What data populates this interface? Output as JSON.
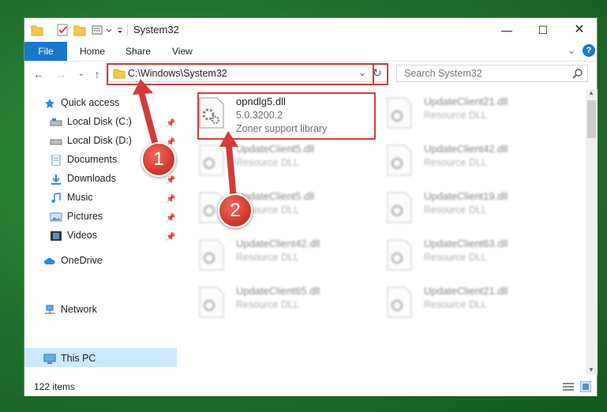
{
  "window": {
    "title": "System32"
  },
  "ribbon": {
    "file": "File",
    "home": "Home",
    "share": "Share",
    "view": "View"
  },
  "address": {
    "path": "C:\\Windows\\System32"
  },
  "search": {
    "placeholder": "Search System32"
  },
  "sidebar": {
    "quick_access": "Quick access",
    "items": [
      "Local Disk (C:)",
      "Local Disk (D:)",
      "Documents",
      "Downloads",
      "Music",
      "Pictures",
      "Videos"
    ],
    "onedrive": "OneDrive",
    "this_pc": "This PC",
    "network": "Network"
  },
  "files": {
    "selected": {
      "name": "opndlg5.dll",
      "version": "5.0.3200.2",
      "desc": "Zoner support library"
    },
    "others": [
      {
        "name": "UpdateClient21.dll",
        "desc": "Resource DLL"
      },
      {
        "name": "UpdateClient5.dll",
        "desc": "Resource DLL"
      },
      {
        "name": "UpdateClient42.dll",
        "desc": "Resource DLL"
      },
      {
        "name": "UpdateClient5.dll",
        "desc": "Resource DLL"
      },
      {
        "name": "UpdateClient19.dll",
        "desc": "Resource DLL"
      },
      {
        "name": "UpdateClient42.dll",
        "desc": "Resource DLL"
      },
      {
        "name": "UpdateClient63.dll",
        "desc": "Resource DLL"
      },
      {
        "name": "UpdateClient65.dll",
        "desc": "Resource DLL"
      },
      {
        "name": "UpdateClient21.dll",
        "desc": "Resource DLL"
      }
    ]
  },
  "status": {
    "count": "122 items"
  },
  "annotations": {
    "step1": "1",
    "step2": "2"
  },
  "colors": {
    "accent": "#1979ca",
    "highlight": "#d33b3b",
    "selection": "#cce8ff"
  }
}
